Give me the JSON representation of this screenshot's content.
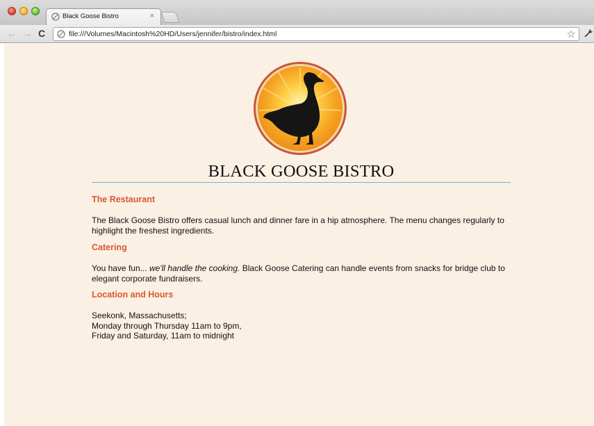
{
  "browser": {
    "tab_title": "Black Goose Bistro",
    "tab_close": "×",
    "url": "file:///Volumes/Macintosh%20HD/Users/jennifer/bistro/index.html",
    "back_icon": "←",
    "forward_icon": "→",
    "reload_icon": "C",
    "star_icon": "☆"
  },
  "page": {
    "title": "BLACK GOOSE BISTRO",
    "logo_icon": "goose-logo-icon",
    "sections": [
      {
        "heading": "The Restaurant",
        "body": "The Black Goose Bistro offers casual lunch and dinner fare in a hip atmosphere. The menu changes regularly to highlight the freshest ingredients."
      },
      {
        "heading": "Catering",
        "body_pre": "You have fun... ",
        "body_em": "we'll handle the cooking.",
        "body_post": " Black Goose Catering can handle events from snacks for bridge club to elegant corporate fundraisers."
      },
      {
        "heading": "Location and Hours",
        "lines": [
          "Seekonk, Massachusetts;",
          "Monday through Thursday 11am to 9pm,",
          "Friday and Saturday, 11am to midnight"
        ]
      }
    ],
    "colors": {
      "background": "#faf0e4",
      "heading": "#d9582f",
      "rule": "#7db3cc"
    }
  }
}
